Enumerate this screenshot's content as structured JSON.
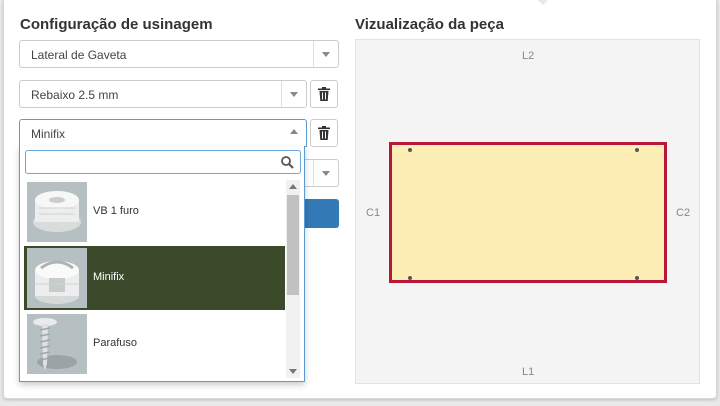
{
  "config": {
    "title": "Configuração de usinagem",
    "piece_select": "Lateral de Gaveta",
    "machining_1": "Rebaixo 2.5 mm",
    "machining_2": "Minifix",
    "search_placeholder": "",
    "options": [
      {
        "label": "VB 1 furo",
        "icon": "cam-connector-image"
      },
      {
        "label": "Minifix",
        "icon": "minifix-image"
      },
      {
        "label": "Parafuso",
        "icon": "screw-image"
      }
    ]
  },
  "preview": {
    "title": "Vizualização da peça",
    "top": "L2",
    "bottom": "L1",
    "left": "C1",
    "right": "C2"
  },
  "colors": {
    "accent": "#337ab7",
    "selected_option": "#3b4a2b",
    "piece_fill": "#fdeeb5",
    "piece_edge": "#b9173a"
  }
}
